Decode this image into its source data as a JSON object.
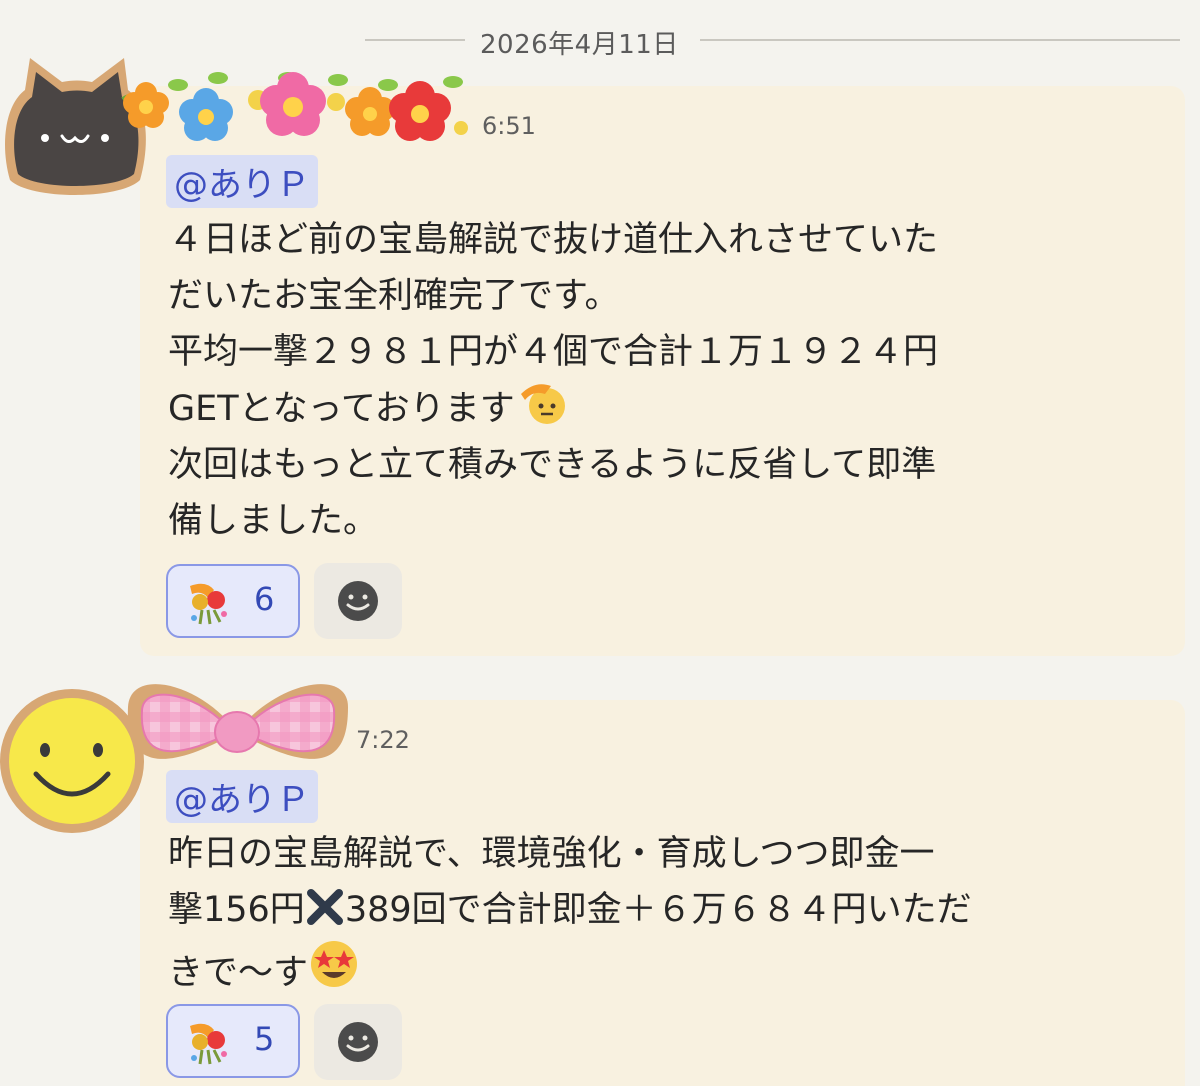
{
  "date_separator": "2026年4月11日",
  "messages": [
    {
      "time": "6:51",
      "mention": "@ありＰ",
      "lines": [
        "４日ほど前の宝島解説で抜け道仕入れさせていた",
        "だいたお宝全利確完了です。",
        "平均一撃２９８１円が４個で合計１万１９２４円",
        "GETとなっております",
        "次回はもっと立て積みできるように反省して即準",
        "備しました。"
      ],
      "reaction_count": "6",
      "avatar_icon": "black-cat-avatar-icon",
      "decoration_icon": "flower-garland-icon",
      "inline_emoji": "saluting-face-icon"
    },
    {
      "time": "7:22",
      "mention": "@ありＰ",
      "lines": [
        "昨日の宝島解説で、環境強化・育成しつつ即金一",
        "撃156円",
        "389回で合計即金＋６万６８４円いただ",
        "きで〜す"
      ],
      "reaction_count": "5",
      "avatar_icon": "smiley-face-avatar-icon",
      "decoration_icon": "pink-ribbon-icon",
      "inline_emoji": "star-struck-icon",
      "cross_icon": "cross-mark-icon"
    }
  ],
  "colors": {
    "background": "#f4f3ee",
    "card": "#f8f1e0",
    "mention_text": "#3d4ec0",
    "mention_bg": "#d9def5",
    "reaction_bg": "#e6e9fb",
    "reaction_border": "#8a98e6"
  }
}
